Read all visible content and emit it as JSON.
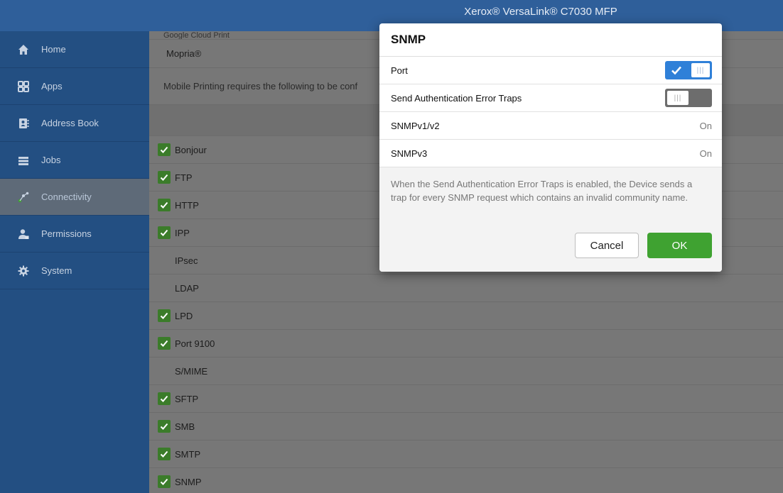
{
  "app": {
    "title": "Xerox® VersaLink® C7030 MFP"
  },
  "sidebar": {
    "items": [
      {
        "label": "Home",
        "icon": "home-icon"
      },
      {
        "label": "Apps",
        "icon": "apps-icon"
      },
      {
        "label": "Address Book",
        "icon": "address-book-icon"
      },
      {
        "label": "Jobs",
        "icon": "jobs-icon"
      },
      {
        "label": "Connectivity",
        "icon": "connectivity-icon",
        "active": true
      },
      {
        "label": "Permissions",
        "icon": "permissions-icon"
      },
      {
        "label": "System",
        "icon": "gear-icon"
      }
    ]
  },
  "main": {
    "cut_item": "Google Cloud Print",
    "mopria": "Mopria®",
    "info_text": "Mobile Printing requires the following to be conf",
    "protocols": [
      {
        "label": "Bonjour",
        "checked": true
      },
      {
        "label": "FTP",
        "checked": true
      },
      {
        "label": "HTTP",
        "checked": true
      },
      {
        "label": "IPP",
        "checked": true
      },
      {
        "label": "IPsec",
        "checked": false
      },
      {
        "label": "LDAP",
        "checked": false
      },
      {
        "label": "LPD",
        "checked": true
      },
      {
        "label": "Port 9100",
        "checked": true
      },
      {
        "label": "S/MIME",
        "checked": false
      },
      {
        "label": "SFTP",
        "checked": true
      },
      {
        "label": "SMB",
        "checked": true
      },
      {
        "label": "SMTP",
        "checked": true
      },
      {
        "label": "SNMP",
        "checked": true
      }
    ]
  },
  "dialog": {
    "title": "SNMP",
    "port_label": "Port",
    "port_state": "on",
    "auth_traps_label": "Send Authentication Error Traps",
    "auth_traps_state": "off",
    "v1v2_label": "SNMPv1/v2",
    "v1v2_value": "On",
    "v3_label": "SNMPv3",
    "v3_value": "On",
    "description": "When the Send Authentication Error Traps is enabled, the Device sends a trap for every SNMP request which contains an invalid community name.",
    "cancel_label": "Cancel",
    "ok_label": "OK"
  },
  "colors": {
    "topbar": "#2f5f9a",
    "sidebar": "#234f82",
    "toggle_on": "#2f80d8",
    "ok_button": "#3fa231",
    "checkbox": "#3b7c2a"
  }
}
